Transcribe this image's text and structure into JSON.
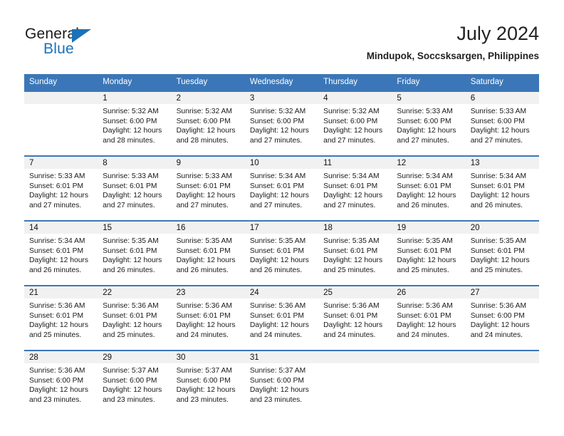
{
  "brand": {
    "name_top": "General",
    "name_bottom": "Blue",
    "color_black": "#1a1a1a",
    "color_blue": "#1b72b8"
  },
  "header": {
    "title": "July 2024",
    "subtitle": "Mindupok, Soccsksargen, Philippines"
  },
  "theme": {
    "header_blue": "#3b77b8",
    "daynum_band": "#f1f1f1",
    "text": "#1a1a1a"
  },
  "calendar": {
    "weekday_headers": [
      "Sunday",
      "Monday",
      "Tuesday",
      "Wednesday",
      "Thursday",
      "Friday",
      "Saturday"
    ],
    "weeks": [
      [
        {
          "day": "",
          "lines": []
        },
        {
          "day": "1",
          "lines": [
            "Sunrise: 5:32 AM",
            "Sunset: 6:00 PM",
            "Daylight: 12 hours",
            "and 28 minutes."
          ]
        },
        {
          "day": "2",
          "lines": [
            "Sunrise: 5:32 AM",
            "Sunset: 6:00 PM",
            "Daylight: 12 hours",
            "and 28 minutes."
          ]
        },
        {
          "day": "3",
          "lines": [
            "Sunrise: 5:32 AM",
            "Sunset: 6:00 PM",
            "Daylight: 12 hours",
            "and 27 minutes."
          ]
        },
        {
          "day": "4",
          "lines": [
            "Sunrise: 5:32 AM",
            "Sunset: 6:00 PM",
            "Daylight: 12 hours",
            "and 27 minutes."
          ]
        },
        {
          "day": "5",
          "lines": [
            "Sunrise: 5:33 AM",
            "Sunset: 6:00 PM",
            "Daylight: 12 hours",
            "and 27 minutes."
          ]
        },
        {
          "day": "6",
          "lines": [
            "Sunrise: 5:33 AM",
            "Sunset: 6:00 PM",
            "Daylight: 12 hours",
            "and 27 minutes."
          ]
        }
      ],
      [
        {
          "day": "7",
          "lines": [
            "Sunrise: 5:33 AM",
            "Sunset: 6:01 PM",
            "Daylight: 12 hours",
            "and 27 minutes."
          ]
        },
        {
          "day": "8",
          "lines": [
            "Sunrise: 5:33 AM",
            "Sunset: 6:01 PM",
            "Daylight: 12 hours",
            "and 27 minutes."
          ]
        },
        {
          "day": "9",
          "lines": [
            "Sunrise: 5:33 AM",
            "Sunset: 6:01 PM",
            "Daylight: 12 hours",
            "and 27 minutes."
          ]
        },
        {
          "day": "10",
          "lines": [
            "Sunrise: 5:34 AM",
            "Sunset: 6:01 PM",
            "Daylight: 12 hours",
            "and 27 minutes."
          ]
        },
        {
          "day": "11",
          "lines": [
            "Sunrise: 5:34 AM",
            "Sunset: 6:01 PM",
            "Daylight: 12 hours",
            "and 27 minutes."
          ]
        },
        {
          "day": "12",
          "lines": [
            "Sunrise: 5:34 AM",
            "Sunset: 6:01 PM",
            "Daylight: 12 hours",
            "and 26 minutes."
          ]
        },
        {
          "day": "13",
          "lines": [
            "Sunrise: 5:34 AM",
            "Sunset: 6:01 PM",
            "Daylight: 12 hours",
            "and 26 minutes."
          ]
        }
      ],
      [
        {
          "day": "14",
          "lines": [
            "Sunrise: 5:34 AM",
            "Sunset: 6:01 PM",
            "Daylight: 12 hours",
            "and 26 minutes."
          ]
        },
        {
          "day": "15",
          "lines": [
            "Sunrise: 5:35 AM",
            "Sunset: 6:01 PM",
            "Daylight: 12 hours",
            "and 26 minutes."
          ]
        },
        {
          "day": "16",
          "lines": [
            "Sunrise: 5:35 AM",
            "Sunset: 6:01 PM",
            "Daylight: 12 hours",
            "and 26 minutes."
          ]
        },
        {
          "day": "17",
          "lines": [
            "Sunrise: 5:35 AM",
            "Sunset: 6:01 PM",
            "Daylight: 12 hours",
            "and 26 minutes."
          ]
        },
        {
          "day": "18",
          "lines": [
            "Sunrise: 5:35 AM",
            "Sunset: 6:01 PM",
            "Daylight: 12 hours",
            "and 25 minutes."
          ]
        },
        {
          "day": "19",
          "lines": [
            "Sunrise: 5:35 AM",
            "Sunset: 6:01 PM",
            "Daylight: 12 hours",
            "and 25 minutes."
          ]
        },
        {
          "day": "20",
          "lines": [
            "Sunrise: 5:35 AM",
            "Sunset: 6:01 PM",
            "Daylight: 12 hours",
            "and 25 minutes."
          ]
        }
      ],
      [
        {
          "day": "21",
          "lines": [
            "Sunrise: 5:36 AM",
            "Sunset: 6:01 PM",
            "Daylight: 12 hours",
            "and 25 minutes."
          ]
        },
        {
          "day": "22",
          "lines": [
            "Sunrise: 5:36 AM",
            "Sunset: 6:01 PM",
            "Daylight: 12 hours",
            "and 25 minutes."
          ]
        },
        {
          "day": "23",
          "lines": [
            "Sunrise: 5:36 AM",
            "Sunset: 6:01 PM",
            "Daylight: 12 hours",
            "and 24 minutes."
          ]
        },
        {
          "day": "24",
          "lines": [
            "Sunrise: 5:36 AM",
            "Sunset: 6:01 PM",
            "Daylight: 12 hours",
            "and 24 minutes."
          ]
        },
        {
          "day": "25",
          "lines": [
            "Sunrise: 5:36 AM",
            "Sunset: 6:01 PM",
            "Daylight: 12 hours",
            "and 24 minutes."
          ]
        },
        {
          "day": "26",
          "lines": [
            "Sunrise: 5:36 AM",
            "Sunset: 6:01 PM",
            "Daylight: 12 hours",
            "and 24 minutes."
          ]
        },
        {
          "day": "27",
          "lines": [
            "Sunrise: 5:36 AM",
            "Sunset: 6:00 PM",
            "Daylight: 12 hours",
            "and 24 minutes."
          ]
        }
      ],
      [
        {
          "day": "28",
          "lines": [
            "Sunrise: 5:36 AM",
            "Sunset: 6:00 PM",
            "Daylight: 12 hours",
            "and 23 minutes."
          ]
        },
        {
          "day": "29",
          "lines": [
            "Sunrise: 5:37 AM",
            "Sunset: 6:00 PM",
            "Daylight: 12 hours",
            "and 23 minutes."
          ]
        },
        {
          "day": "30",
          "lines": [
            "Sunrise: 5:37 AM",
            "Sunset: 6:00 PM",
            "Daylight: 12 hours",
            "and 23 minutes."
          ]
        },
        {
          "day": "31",
          "lines": [
            "Sunrise: 5:37 AM",
            "Sunset: 6:00 PM",
            "Daylight: 12 hours",
            "and 23 minutes."
          ]
        },
        {
          "day": "",
          "lines": []
        },
        {
          "day": "",
          "lines": []
        },
        {
          "day": "",
          "lines": []
        }
      ]
    ]
  }
}
